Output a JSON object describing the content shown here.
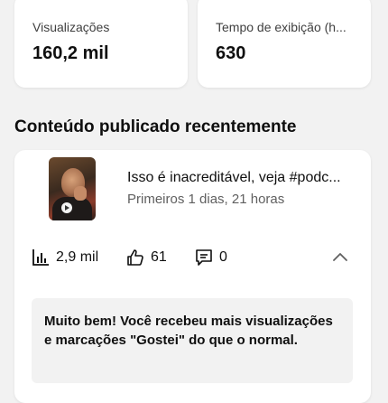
{
  "stats": [
    {
      "label": "Visualizações",
      "value": "160,2 mil"
    },
    {
      "label": "Tempo de exibição (h...",
      "value": "630"
    }
  ],
  "section_title": "Conteúdo publicado recentemente",
  "video": {
    "title": "Isso é inacreditável, veja #podc...",
    "subtitle": "Primeiros 1 dias, 21 horas",
    "views": "2,9 mil",
    "likes": "61",
    "comments": "0"
  },
  "notice": "Muito bem! Você recebeu mais visualizações e marcações \"Gostei\" do que o normal.",
  "icons": {
    "views": "bar-chart-icon",
    "likes": "thumbs-up-icon",
    "comments": "comment-icon",
    "collapse": "chevron-up-icon"
  }
}
